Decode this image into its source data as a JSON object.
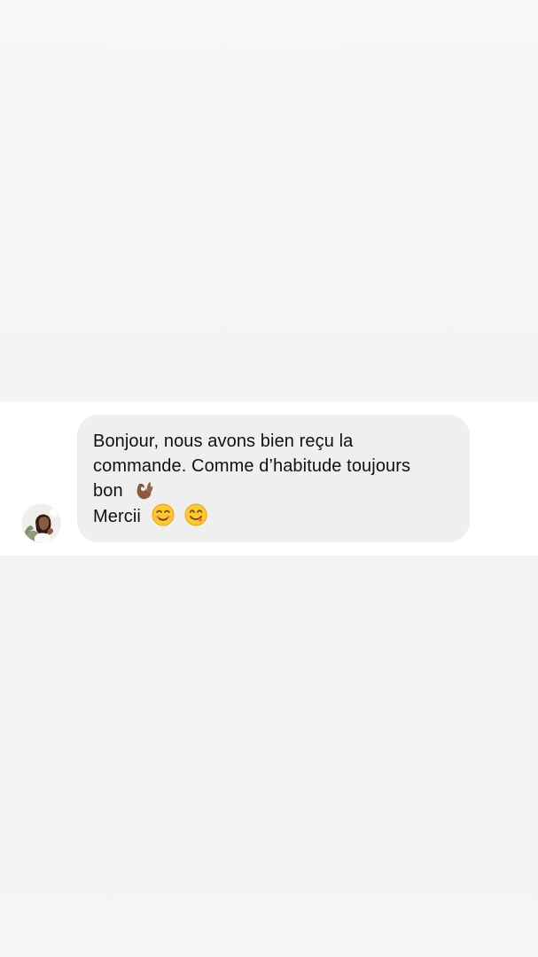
{
  "conversation": {
    "avatar_icon": "contact-avatar-icon",
    "message": {
      "line1": "Bonjour, nous avons bien reçu la",
      "line2": "commande. Comme d’habitude toujours",
      "line3": "bon",
      "line4": "Mercii"
    },
    "emojis": [
      "ok-hand-emoji",
      "smiling-face-emoji",
      "face-savoring-food-emoji"
    ]
  },
  "colors": {
    "background": "#f5f5f5",
    "message_strip": "#ffffff",
    "bubble": "#efefef",
    "text": "#111111"
  }
}
